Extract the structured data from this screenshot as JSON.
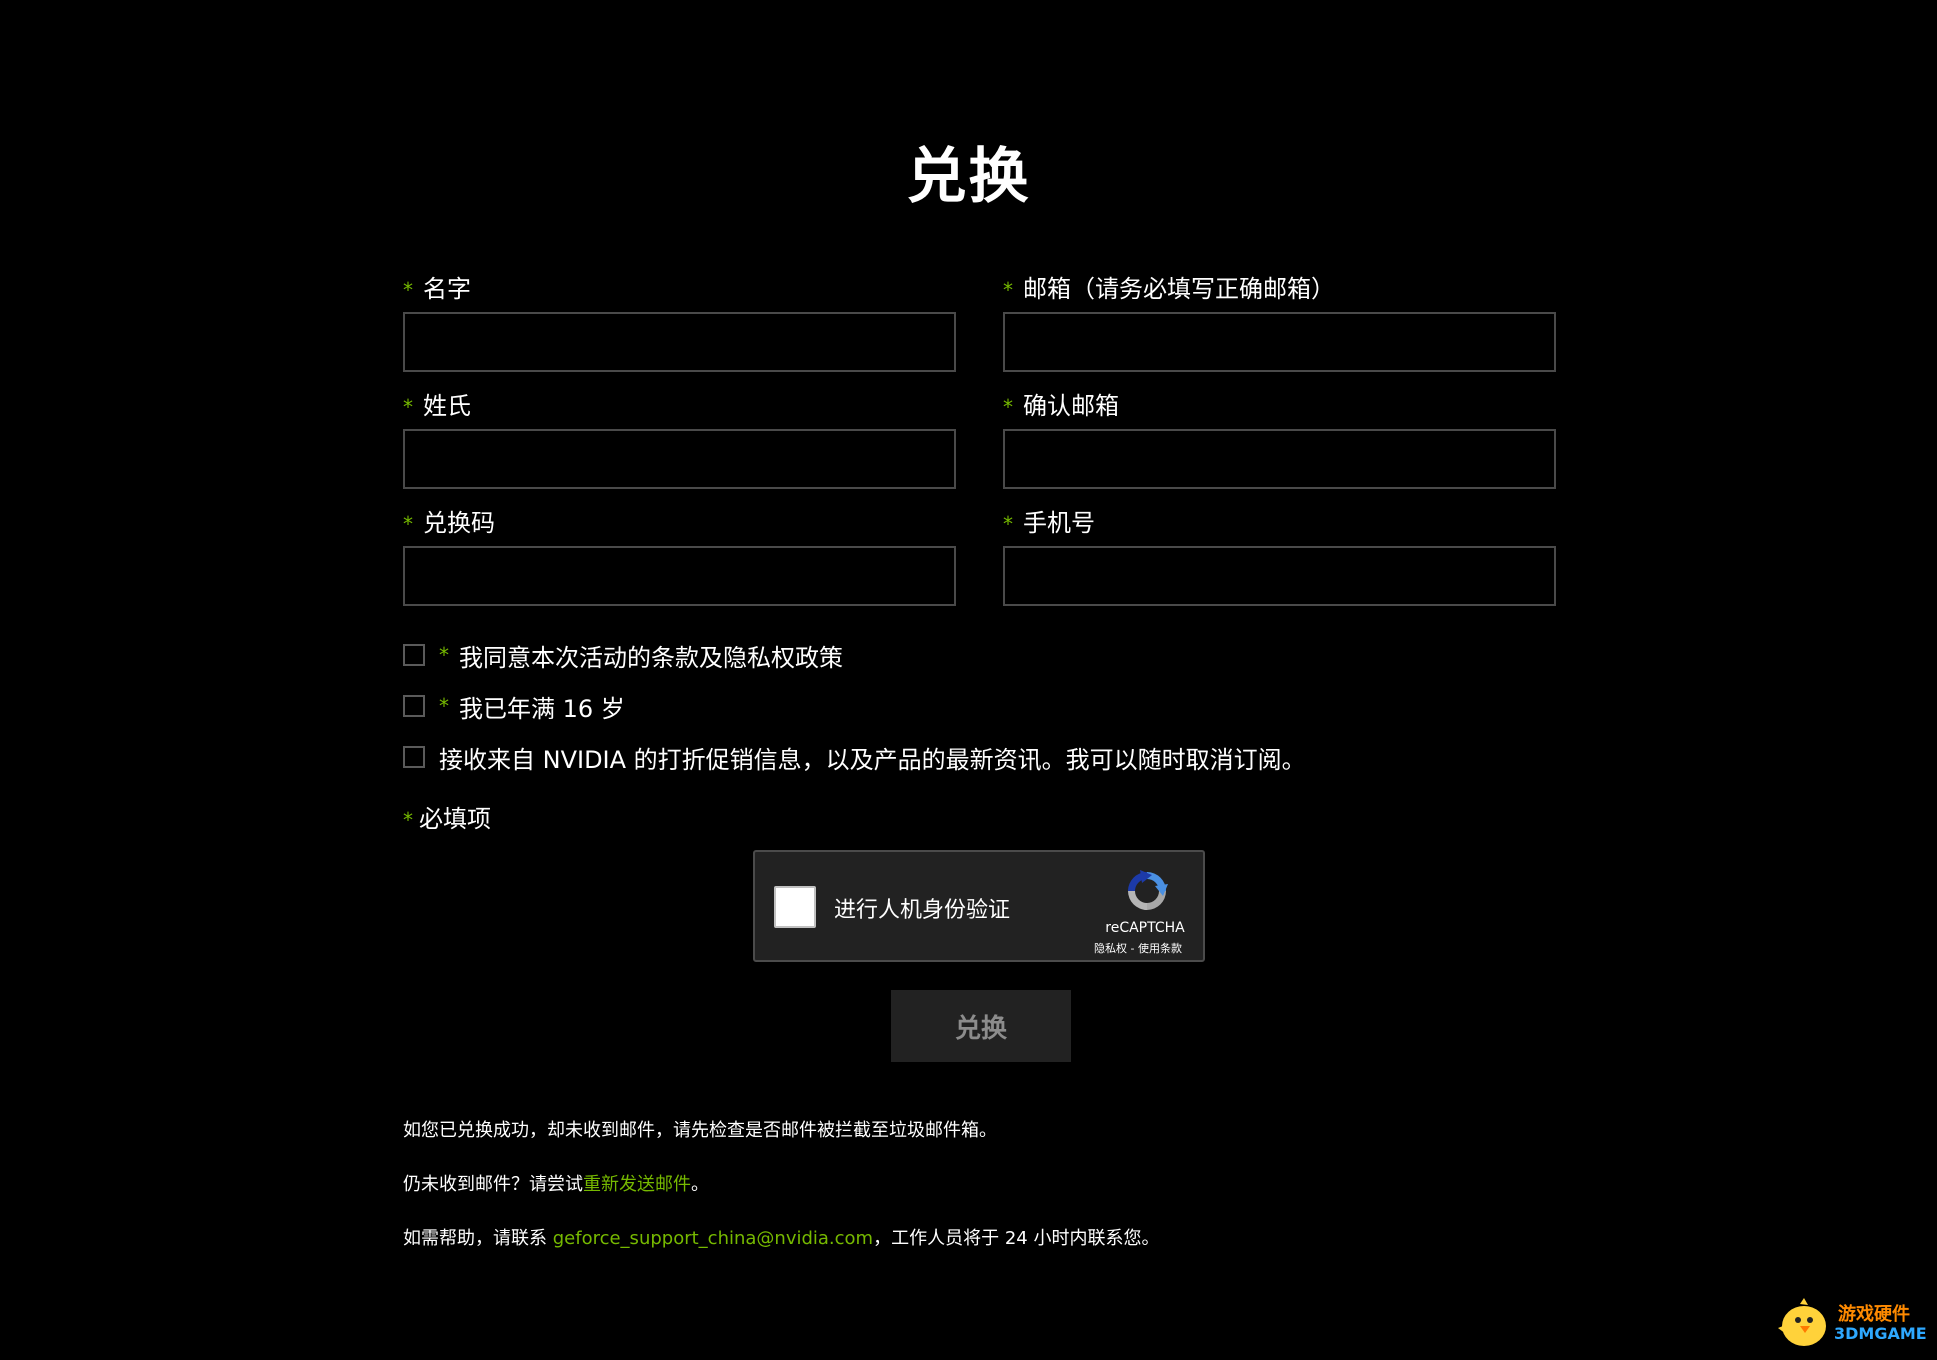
{
  "page": {
    "title": "兑换"
  },
  "form": {
    "required_mark": "*",
    "fields": {
      "first_name": {
        "label": "名字",
        "value": ""
      },
      "email": {
        "label": "邮箱（请务必填写正确邮箱）",
        "value": ""
      },
      "last_name": {
        "label": "姓氏",
        "value": ""
      },
      "confirm_email": {
        "label": "确认邮箱",
        "value": ""
      },
      "code": {
        "label": "兑换码",
        "value": ""
      },
      "phone": {
        "label": "手机号",
        "value": ""
      }
    },
    "checkboxes": {
      "terms": {
        "label": "我同意本次活动的条款及隐私权政策",
        "required": true,
        "checked": false
      },
      "age": {
        "label": "我已年满 16 岁",
        "required": true,
        "checked": false
      },
      "marketing": {
        "label": "接收来自 NVIDIA 的打折促销信息，以及产品的最新资讯。我可以随时取消订阅。",
        "required": false,
        "checked": false
      }
    },
    "required_note": "必填项",
    "submit_label": "兑换"
  },
  "recaptcha": {
    "label": "进行人机身份验证",
    "brand": "reCAPTCHA",
    "links": "隐私权 - 使用条款"
  },
  "info": {
    "line1": "如您已兑换成功，却未收到邮件，请先检查是否邮件被拦截至垃圾邮件箱。",
    "line2_prefix": "仍未收到邮件？请尝试",
    "line2_link": "重新发送邮件",
    "line2_suffix": "。",
    "line3_prefix": "如需帮助，请联系 ",
    "line3_email": "geforce_support_china@nvidia.com",
    "line3_suffix": "，工作人员将于 24 小时内联系您。"
  },
  "watermark": {
    "line1": "游戏硬件",
    "line2": "3DMGAME"
  },
  "colors": {
    "accent": "#76b900",
    "background": "#000000",
    "input_border": "#4a4a4a"
  }
}
